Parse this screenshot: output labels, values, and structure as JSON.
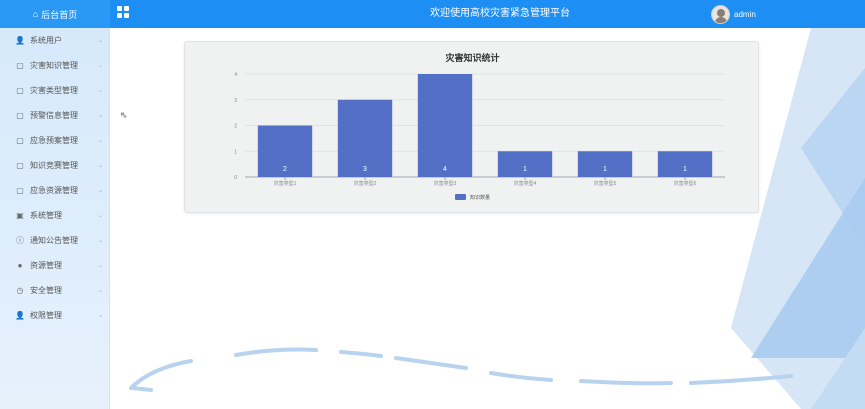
{
  "header": {
    "home_label": "后台首页",
    "title": "欢迎使用高校灾害紧急管理平台",
    "username": "admin"
  },
  "sidebar": {
    "items": [
      {
        "label": "系统用户",
        "icon": "user-icon"
      },
      {
        "label": "灾害知识管理",
        "icon": "document-icon"
      },
      {
        "label": "灾害类型管理",
        "icon": "document-icon"
      },
      {
        "label": "预警信息管理",
        "icon": "document-icon"
      },
      {
        "label": "应急预案管理",
        "icon": "document-icon"
      },
      {
        "label": "知识竞赛管理",
        "icon": "document-icon"
      },
      {
        "label": "应急资源管理",
        "icon": "document-icon"
      },
      {
        "label": "系统管理",
        "icon": "image-icon"
      },
      {
        "label": "通知公告管理",
        "icon": "info-icon"
      },
      {
        "label": "资源管理",
        "icon": "location-icon"
      },
      {
        "label": "安全管理",
        "icon": "clock-icon"
      },
      {
        "label": "权限管理",
        "icon": "user-icon"
      }
    ]
  },
  "chart_data": {
    "type": "bar",
    "title": "灾害知识统计",
    "categories": [
      "灾害类型1",
      "灾害类型2",
      "灾害类型3",
      "灾害类型4",
      "灾害类型5",
      "灾害类型6"
    ],
    "series": [
      {
        "name": "知识数量",
        "values": [
          2,
          3,
          4,
          1,
          1,
          1
        ],
        "color": "#5470c6"
      }
    ],
    "ylim": [
      0,
      4
    ],
    "yticks": [
      0,
      1,
      2,
      3,
      4
    ],
    "grid": true,
    "legend": "bottom-center"
  }
}
